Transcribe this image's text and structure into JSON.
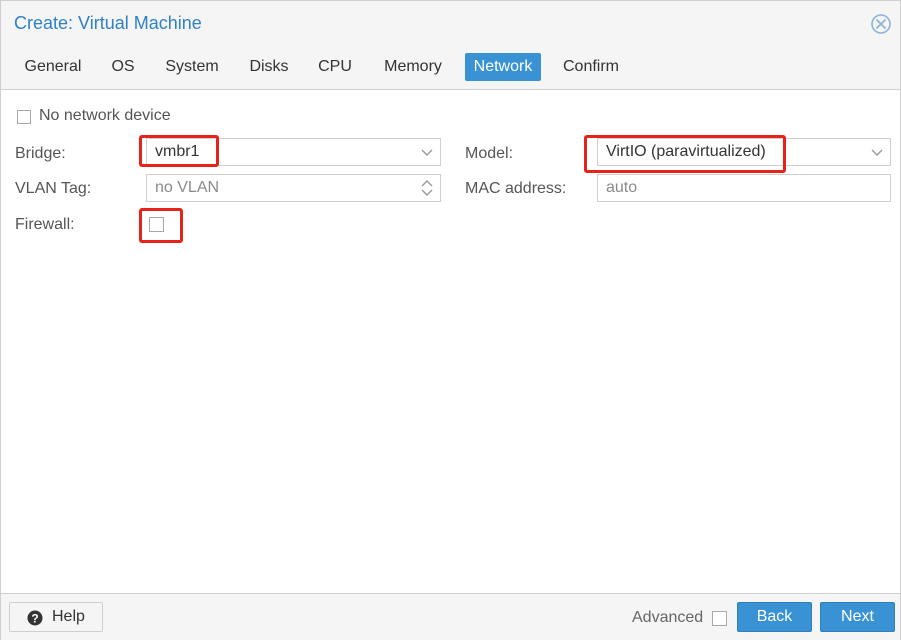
{
  "window": {
    "title": "Create: Virtual Machine"
  },
  "tabs": [
    {
      "label": "General"
    },
    {
      "label": "OS"
    },
    {
      "label": "System"
    },
    {
      "label": "Disks"
    },
    {
      "label": "CPU"
    },
    {
      "label": "Memory"
    },
    {
      "label": "Network",
      "active": true
    },
    {
      "label": "Confirm"
    }
  ],
  "form": {
    "no_network_label": "No network device",
    "bridge_label": "Bridge:",
    "bridge_value": "vmbr1",
    "vlan_label": "VLAN Tag:",
    "vlan_value": "no VLAN",
    "firewall_label": "Firewall:",
    "model_label": "Model:",
    "model_value": "VirtIO (paravirtualized)",
    "mac_label": "MAC address:",
    "mac_value": "auto"
  },
  "footer": {
    "help_label": "Help",
    "advanced_label": "Advanced",
    "back_label": "Back",
    "next_label": "Next"
  },
  "colors": {
    "accent": "#3892d4",
    "title": "#2f81c4",
    "highlight": "#e5231b"
  }
}
